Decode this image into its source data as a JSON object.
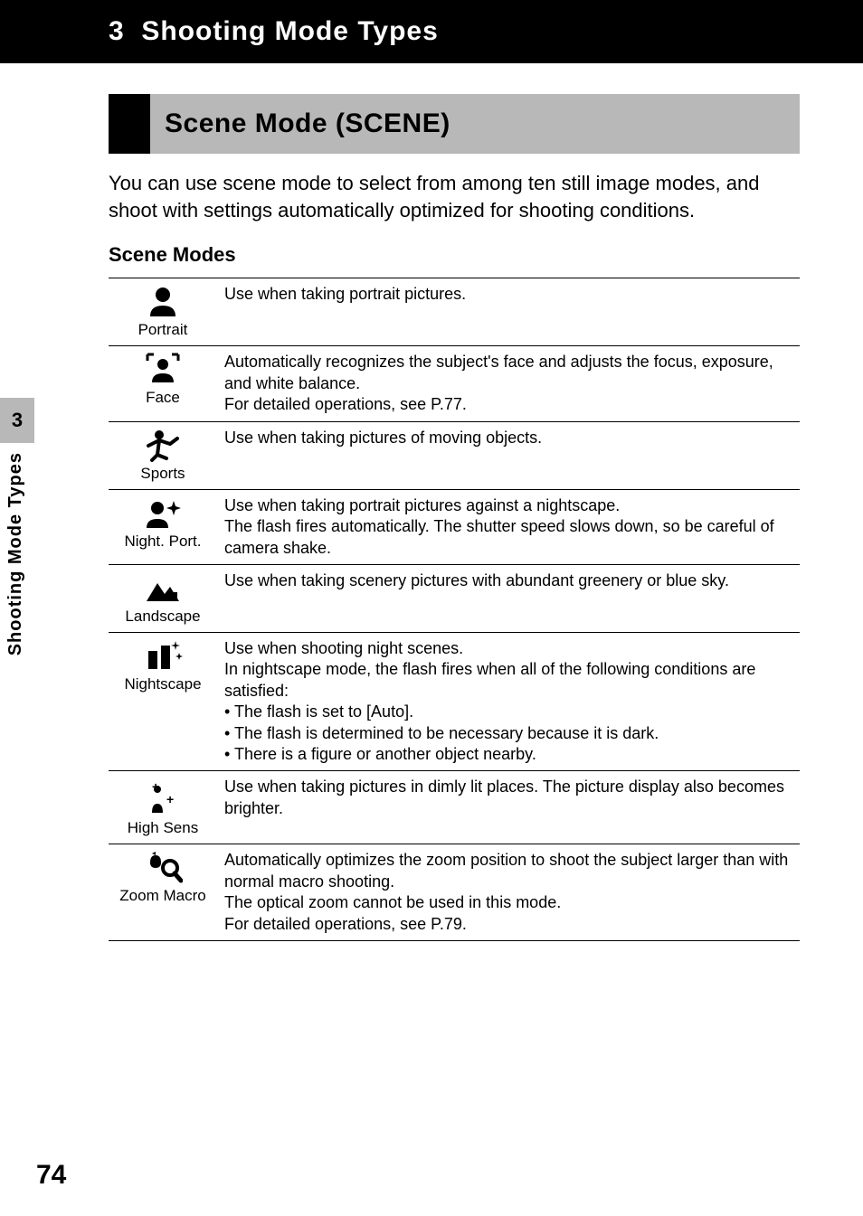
{
  "chapter": {
    "number": "3",
    "title": "Shooting Mode Types"
  },
  "section": {
    "title": "Scene Mode (SCENE)"
  },
  "intro": "You can use scene mode to select from among ten still image modes, and shoot with settings automatically optimized for shooting conditions.",
  "scene_modes_label": "Scene Modes",
  "modes": [
    {
      "name": "Portrait",
      "desc": "Use when taking portrait pictures."
    },
    {
      "name": "Face",
      "desc": "Automatically recognizes the subject's face and adjusts the focus, exposure, and white balance.\nFor detailed operations, see P.77."
    },
    {
      "name": "Sports",
      "desc": "Use when taking pictures of moving objects."
    },
    {
      "name": "Night. Port.",
      "desc": "Use when taking portrait pictures against a nightscape.\nThe flash fires automatically. The shutter speed slows down, so be careful of camera shake."
    },
    {
      "name": "Landscape",
      "desc": "Use when taking scenery pictures with abundant greenery or blue sky."
    },
    {
      "name": "Nightscape",
      "desc_lead": "Use when shooting night scenes.\nIn nightscape mode, the flash fires when all of the following conditions are satisfied:",
      "bullets": [
        "The flash is set to [Auto].",
        "The flash is determined to be necessary because it is dark.",
        "There is a figure or another object nearby."
      ]
    },
    {
      "name": "High Sens",
      "desc": "Use when taking pictures in dimly lit places. The picture display also becomes brighter."
    },
    {
      "name": "Zoom Macro",
      "desc": "Automatically optimizes the zoom position to shoot the subject larger than with normal macro shooting.\nThe optical zoom cannot be used in this mode.\nFor detailed operations, see P.79."
    }
  ],
  "side_tab": {
    "num": "3",
    "text": "Shooting Mode Types"
  },
  "page_num": "74"
}
